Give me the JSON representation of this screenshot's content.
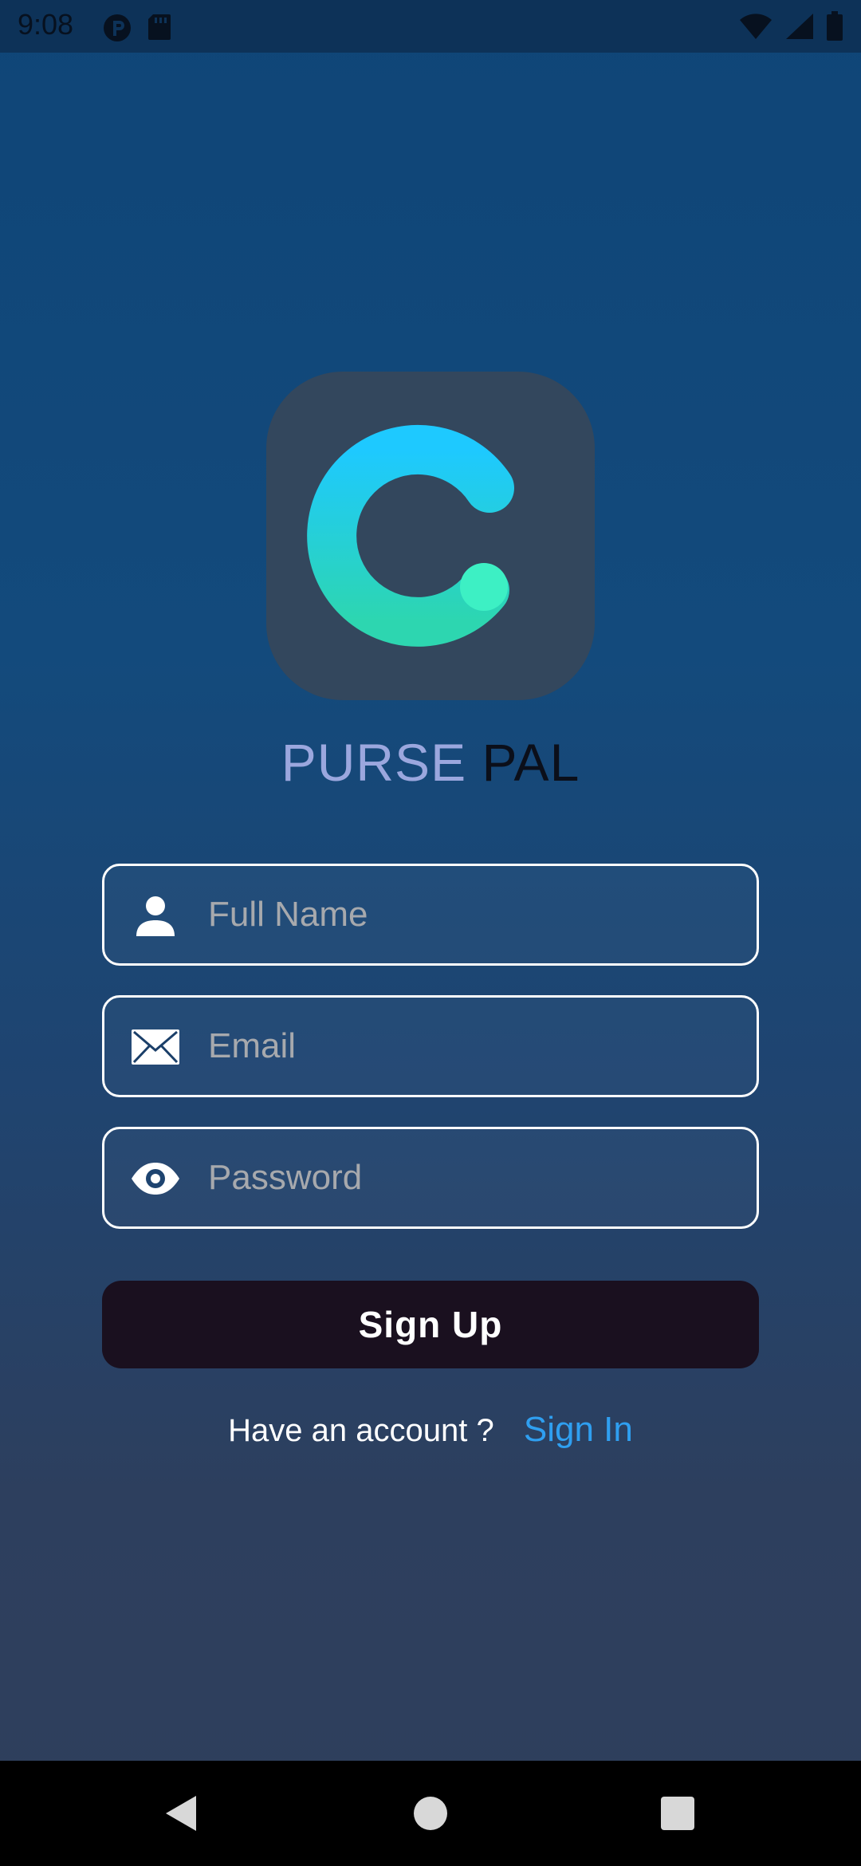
{
  "status_bar": {
    "time": "9:08",
    "left_icons": [
      "notification-icon",
      "sd-card-icon"
    ],
    "right_icons": [
      "wifi-icon",
      "cell-signal-icon",
      "battery-icon"
    ]
  },
  "brand": {
    "logo_icon": "c-logo-icon",
    "name_part1": "PURSE",
    "name_part2": "PAL"
  },
  "form": {
    "full_name": {
      "placeholder": "Full Name",
      "value": "",
      "icon": "person-icon"
    },
    "email": {
      "placeholder": "Email",
      "value": "",
      "icon": "mail-icon"
    },
    "password": {
      "placeholder": "Password",
      "value": "",
      "icon": "eye-icon"
    },
    "submit_label": "Sign Up"
  },
  "footer": {
    "prompt": "Have an account ?",
    "signin_label": "Sign In"
  },
  "nav_bar": {
    "buttons": [
      "back-icon",
      "home-icon",
      "recents-icon"
    ]
  },
  "colors": {
    "background_top": "#0f4577",
    "background_bottom": "#2f3f5c",
    "logo_tile": "#33475d",
    "brand_accent": "#9ba7de",
    "brand_dark": "#0b0f1a",
    "button_bg": "#1a101f",
    "link": "#2f9ff0",
    "logo_gradient_top": "#1ec9ff",
    "logo_gradient_bottom": "#2dd6b0"
  }
}
